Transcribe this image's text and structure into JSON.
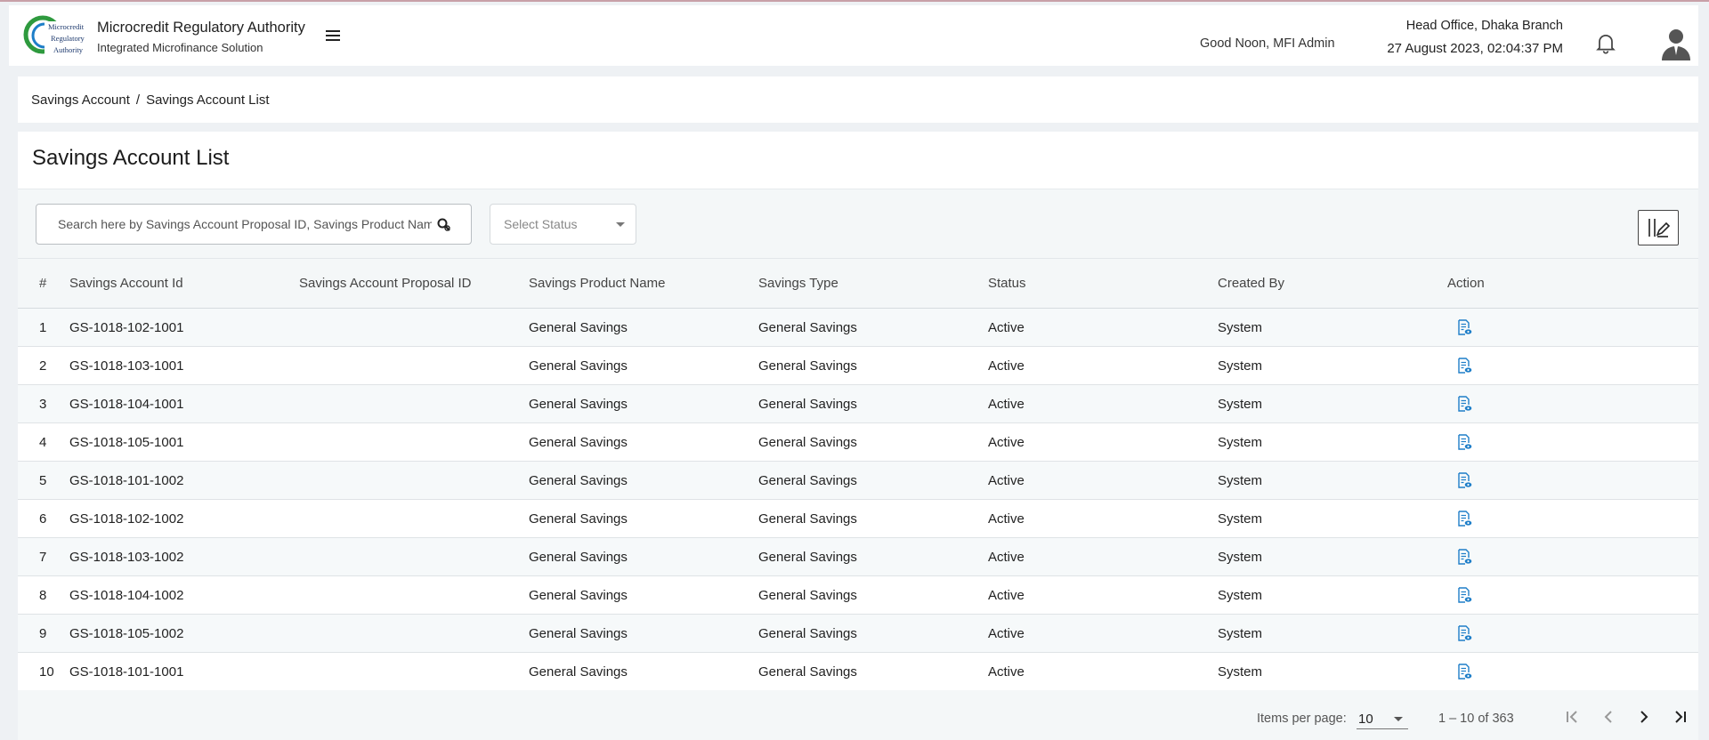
{
  "header": {
    "logo_text": [
      "Microcredit",
      "Regulatory",
      "Authority"
    ],
    "title": "Microcredit Regulatory Authority",
    "subtitle": "Integrated Microfinance Solution",
    "greeting": "Good Noon, MFI Admin",
    "branch": "Head Office, Dhaka Branch",
    "datetime": "27 August 2023, 02:04:37 PM"
  },
  "breadcrumb": {
    "parent": "Savings Account",
    "separator": "/",
    "current": "Savings Account List"
  },
  "page": {
    "title": "Savings Account List"
  },
  "filters": {
    "search_placeholder": "Search here by Savings Account Proposal ID, Savings Product Name",
    "status_placeholder": "Select Status"
  },
  "table": {
    "headers": {
      "num": "#",
      "account_id": "Savings Account Id",
      "proposal_id": "Savings Account Proposal ID",
      "product_name": "Savings Product Name",
      "savings_type": "Savings Type",
      "status": "Status",
      "created_by": "Created By",
      "action": "Action"
    },
    "rows": [
      {
        "num": "1",
        "account_id": "GS-1018-102-1001",
        "proposal_id": "",
        "product_name": "General Savings",
        "savings_type": "General Savings",
        "status": "Active",
        "created_by": "System"
      },
      {
        "num": "2",
        "account_id": "GS-1018-103-1001",
        "proposal_id": "",
        "product_name": "General Savings",
        "savings_type": "General Savings",
        "status": "Active",
        "created_by": "System"
      },
      {
        "num": "3",
        "account_id": "GS-1018-104-1001",
        "proposal_id": "",
        "product_name": "General Savings",
        "savings_type": "General Savings",
        "status": "Active",
        "created_by": "System"
      },
      {
        "num": "4",
        "account_id": "GS-1018-105-1001",
        "proposal_id": "",
        "product_name": "General Savings",
        "savings_type": "General Savings",
        "status": "Active",
        "created_by": "System"
      },
      {
        "num": "5",
        "account_id": "GS-1018-101-1002",
        "proposal_id": "",
        "product_name": "General Savings",
        "savings_type": "General Savings",
        "status": "Active",
        "created_by": "System"
      },
      {
        "num": "6",
        "account_id": "GS-1018-102-1002",
        "proposal_id": "",
        "product_name": "General Savings",
        "savings_type": "General Savings",
        "status": "Active",
        "created_by": "System"
      },
      {
        "num": "7",
        "account_id": "GS-1018-103-1002",
        "proposal_id": "",
        "product_name": "General Savings",
        "savings_type": "General Savings",
        "status": "Active",
        "created_by": "System"
      },
      {
        "num": "8",
        "account_id": "GS-1018-104-1002",
        "proposal_id": "",
        "product_name": "General Savings",
        "savings_type": "General Savings",
        "status": "Active",
        "created_by": "System"
      },
      {
        "num": "9",
        "account_id": "GS-1018-105-1002",
        "proposal_id": "",
        "product_name": "General Savings",
        "savings_type": "General Savings",
        "status": "Active",
        "created_by": "System"
      },
      {
        "num": "10",
        "account_id": "GS-1018-101-1001",
        "proposal_id": "",
        "product_name": "General Savings",
        "savings_type": "General Savings",
        "status": "Active",
        "created_by": "System"
      }
    ],
    "row_action_icon": "view-document-icon"
  },
  "paginator": {
    "items_per_page_label": "Items per page:",
    "items_per_page": "10",
    "range": "1 – 10 of 363"
  },
  "colors": {
    "accent": "#1e7ec8",
    "logo_green": "#2e9a3e"
  }
}
